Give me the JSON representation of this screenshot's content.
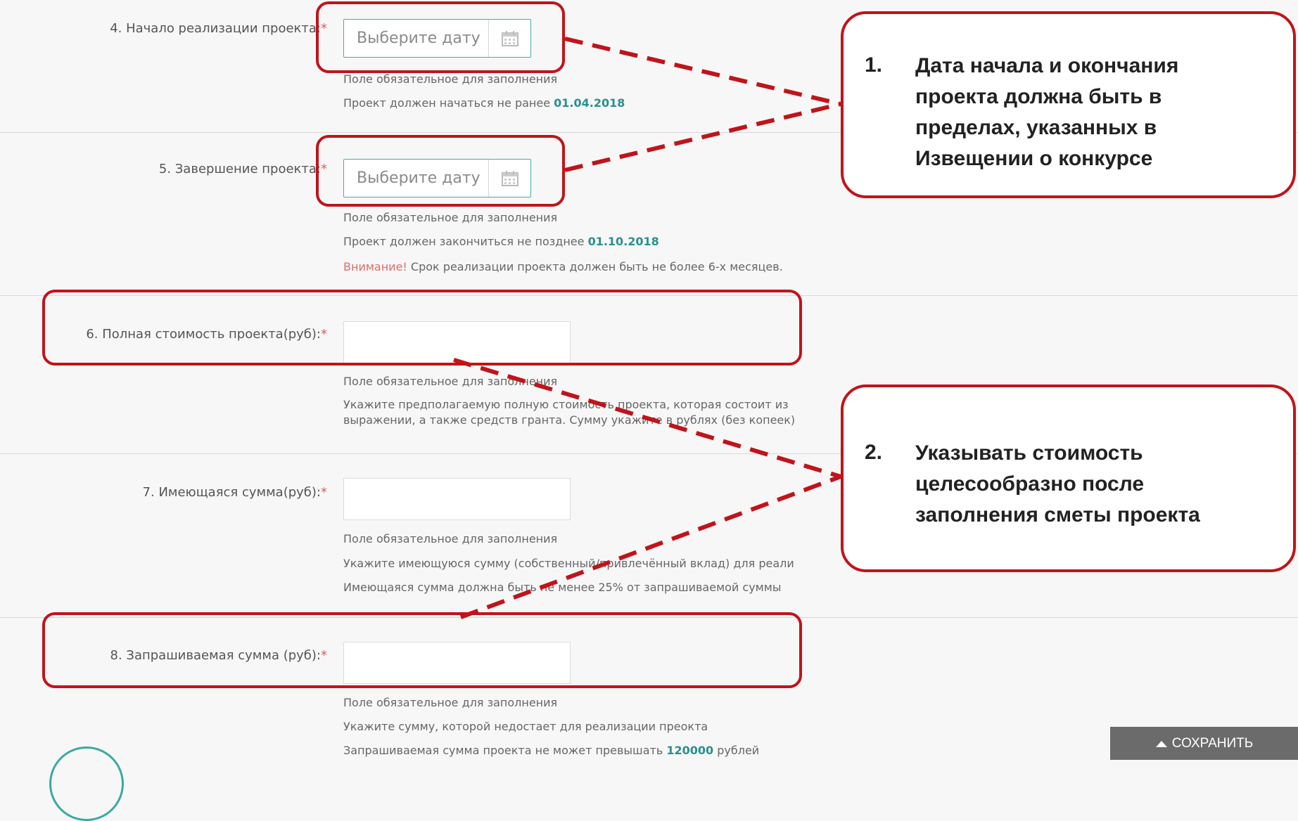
{
  "fields": {
    "start": {
      "label": "4. Начало реализации проекта:",
      "req": "*",
      "placeholder": "Выберите дату",
      "hint_required": "Поле обязательное для заполнения",
      "hint_prefix": "Проект должен начаться не ранее",
      "hint_date": "01.04.2018"
    },
    "end": {
      "label": "5. Завершение проекта:",
      "req": "*",
      "placeholder": "Выберите дату",
      "hint_required": "Поле обязательное для заполнения",
      "hint_prefix": "Проект должен закончиться не позднее",
      "hint_date": "01.10.2018",
      "warn_word": "Внимание!",
      "warn_text": "Срок реализации проекта должен быть не более 6-х месяцев."
    },
    "full_cost": {
      "label": "6. Полная стоимость проекта(руб):",
      "req": "*",
      "value": "",
      "hint_required": "Поле обязательное для заполнения",
      "hint_line1": "Укажите предполагаемую полную стоимость проекта, которая состоит из",
      "hint_line2": "выражении, а также средств гранта. Сумму укажите в рублях (без копеек)"
    },
    "available": {
      "label": "7. Имеющаяся сумма(руб):",
      "req": "*",
      "value": "",
      "hint_required": "Поле обязательное для заполнения",
      "hint_line1": "Укажите имеющуюся сумму (собственный/привлечённый вклад) для реали",
      "hint_line2": "Имеющаяся сумма должна быть не менее 25% от запрашиваемой суммы"
    },
    "requested": {
      "label": "8. Запрашиваемая сумма (руб):",
      "req": "*",
      "value": "",
      "hint_required": "Поле обязательное для заполнения",
      "hint_line1": "Укажите сумму, которой недостает для реализации преокта",
      "hint_prefix": "Запрашиваемая сумма проекта не может превышать",
      "hint_amount": "120000",
      "hint_suffix": "рублей"
    }
  },
  "callouts": [
    {
      "num": "1.",
      "lines": [
        "Дата начала и окончания",
        "проекта должна быть в",
        "пределах, указанных в",
        "Извещении о конкурсе"
      ]
    },
    {
      "num": "2.",
      "lines": [
        "Указывать стоимость",
        "целесообразно после",
        "заполнения сметы проекта"
      ]
    }
  ],
  "save_button": {
    "label": "СОХРАНИТЬ",
    "icon": "chevron-up-icon"
  },
  "colors": {
    "accent": "#2a8f8f",
    "annotation_red": "#c0141a",
    "required": "#e05a5a"
  }
}
